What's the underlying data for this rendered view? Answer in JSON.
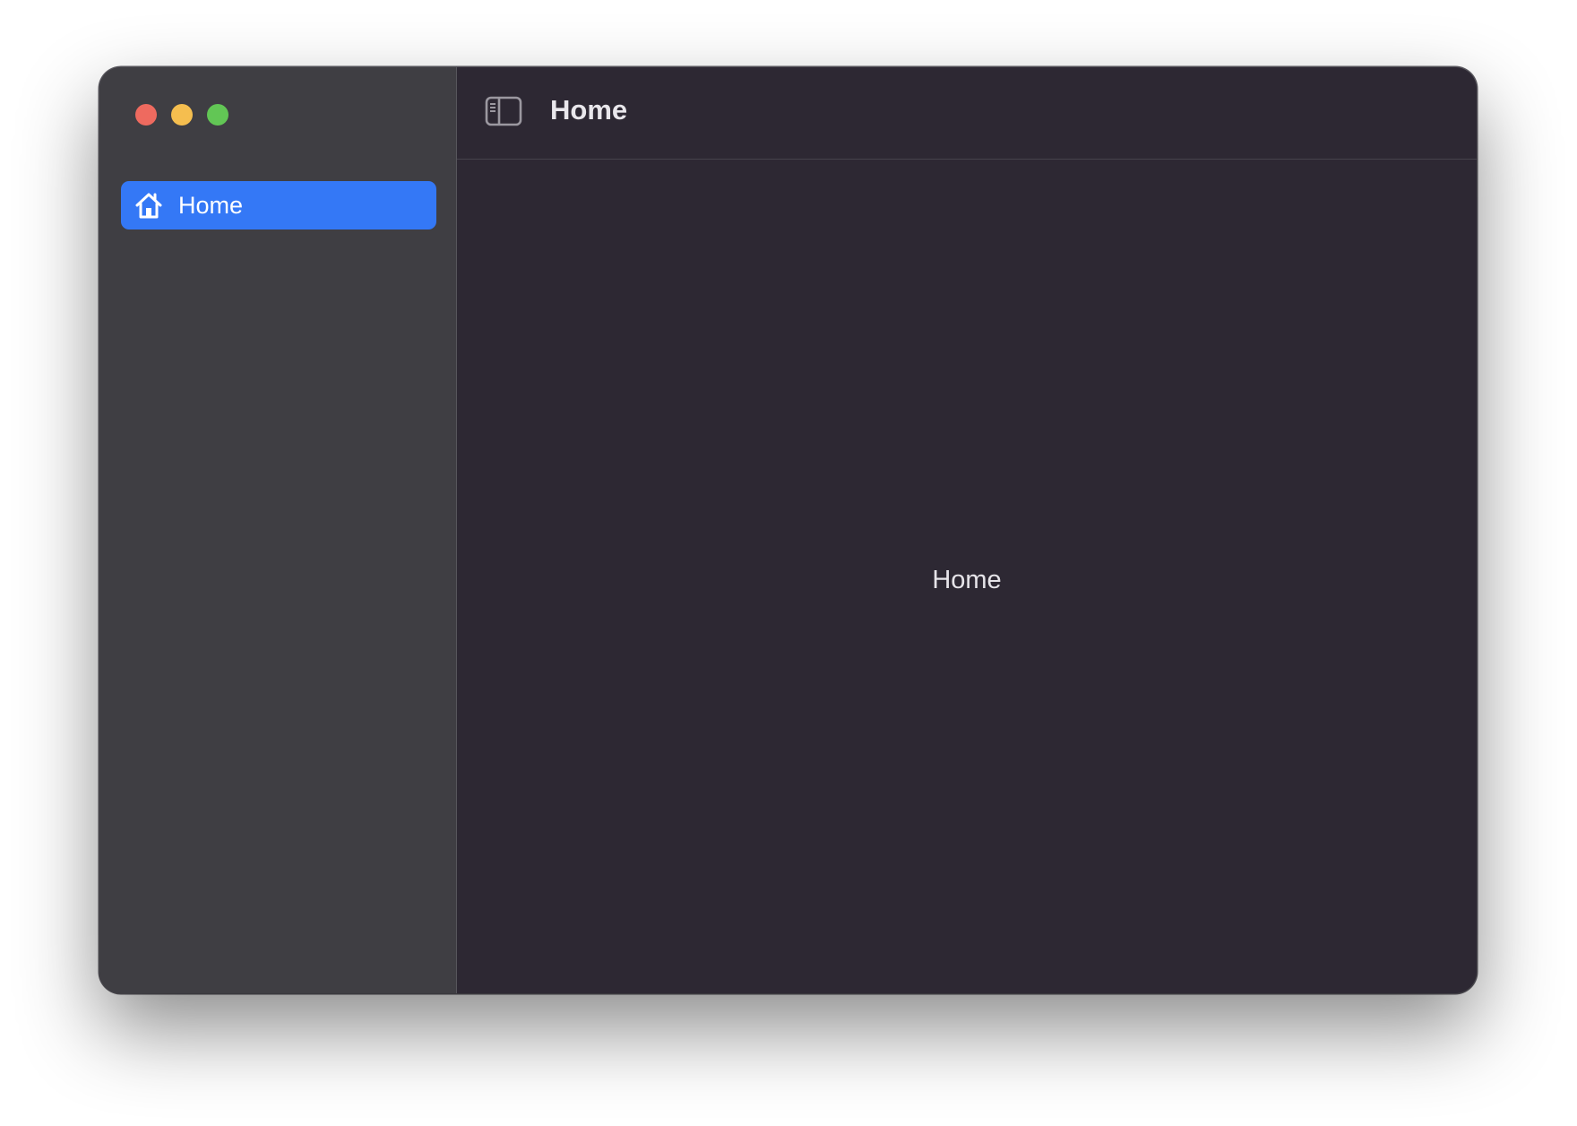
{
  "window": {
    "traffic_lights": {
      "close_color": "#ee6a5f",
      "minimize_color": "#f5be4f",
      "zoom_color": "#62c655"
    }
  },
  "sidebar": {
    "items": [
      {
        "label": "Home",
        "icon": "house-icon",
        "selected": true,
        "accent": "#3478f6"
      }
    ]
  },
  "toolbar": {
    "toggle_icon": "sidebar-toggle-icon",
    "title": "Home"
  },
  "main": {
    "content_text": "Home"
  }
}
